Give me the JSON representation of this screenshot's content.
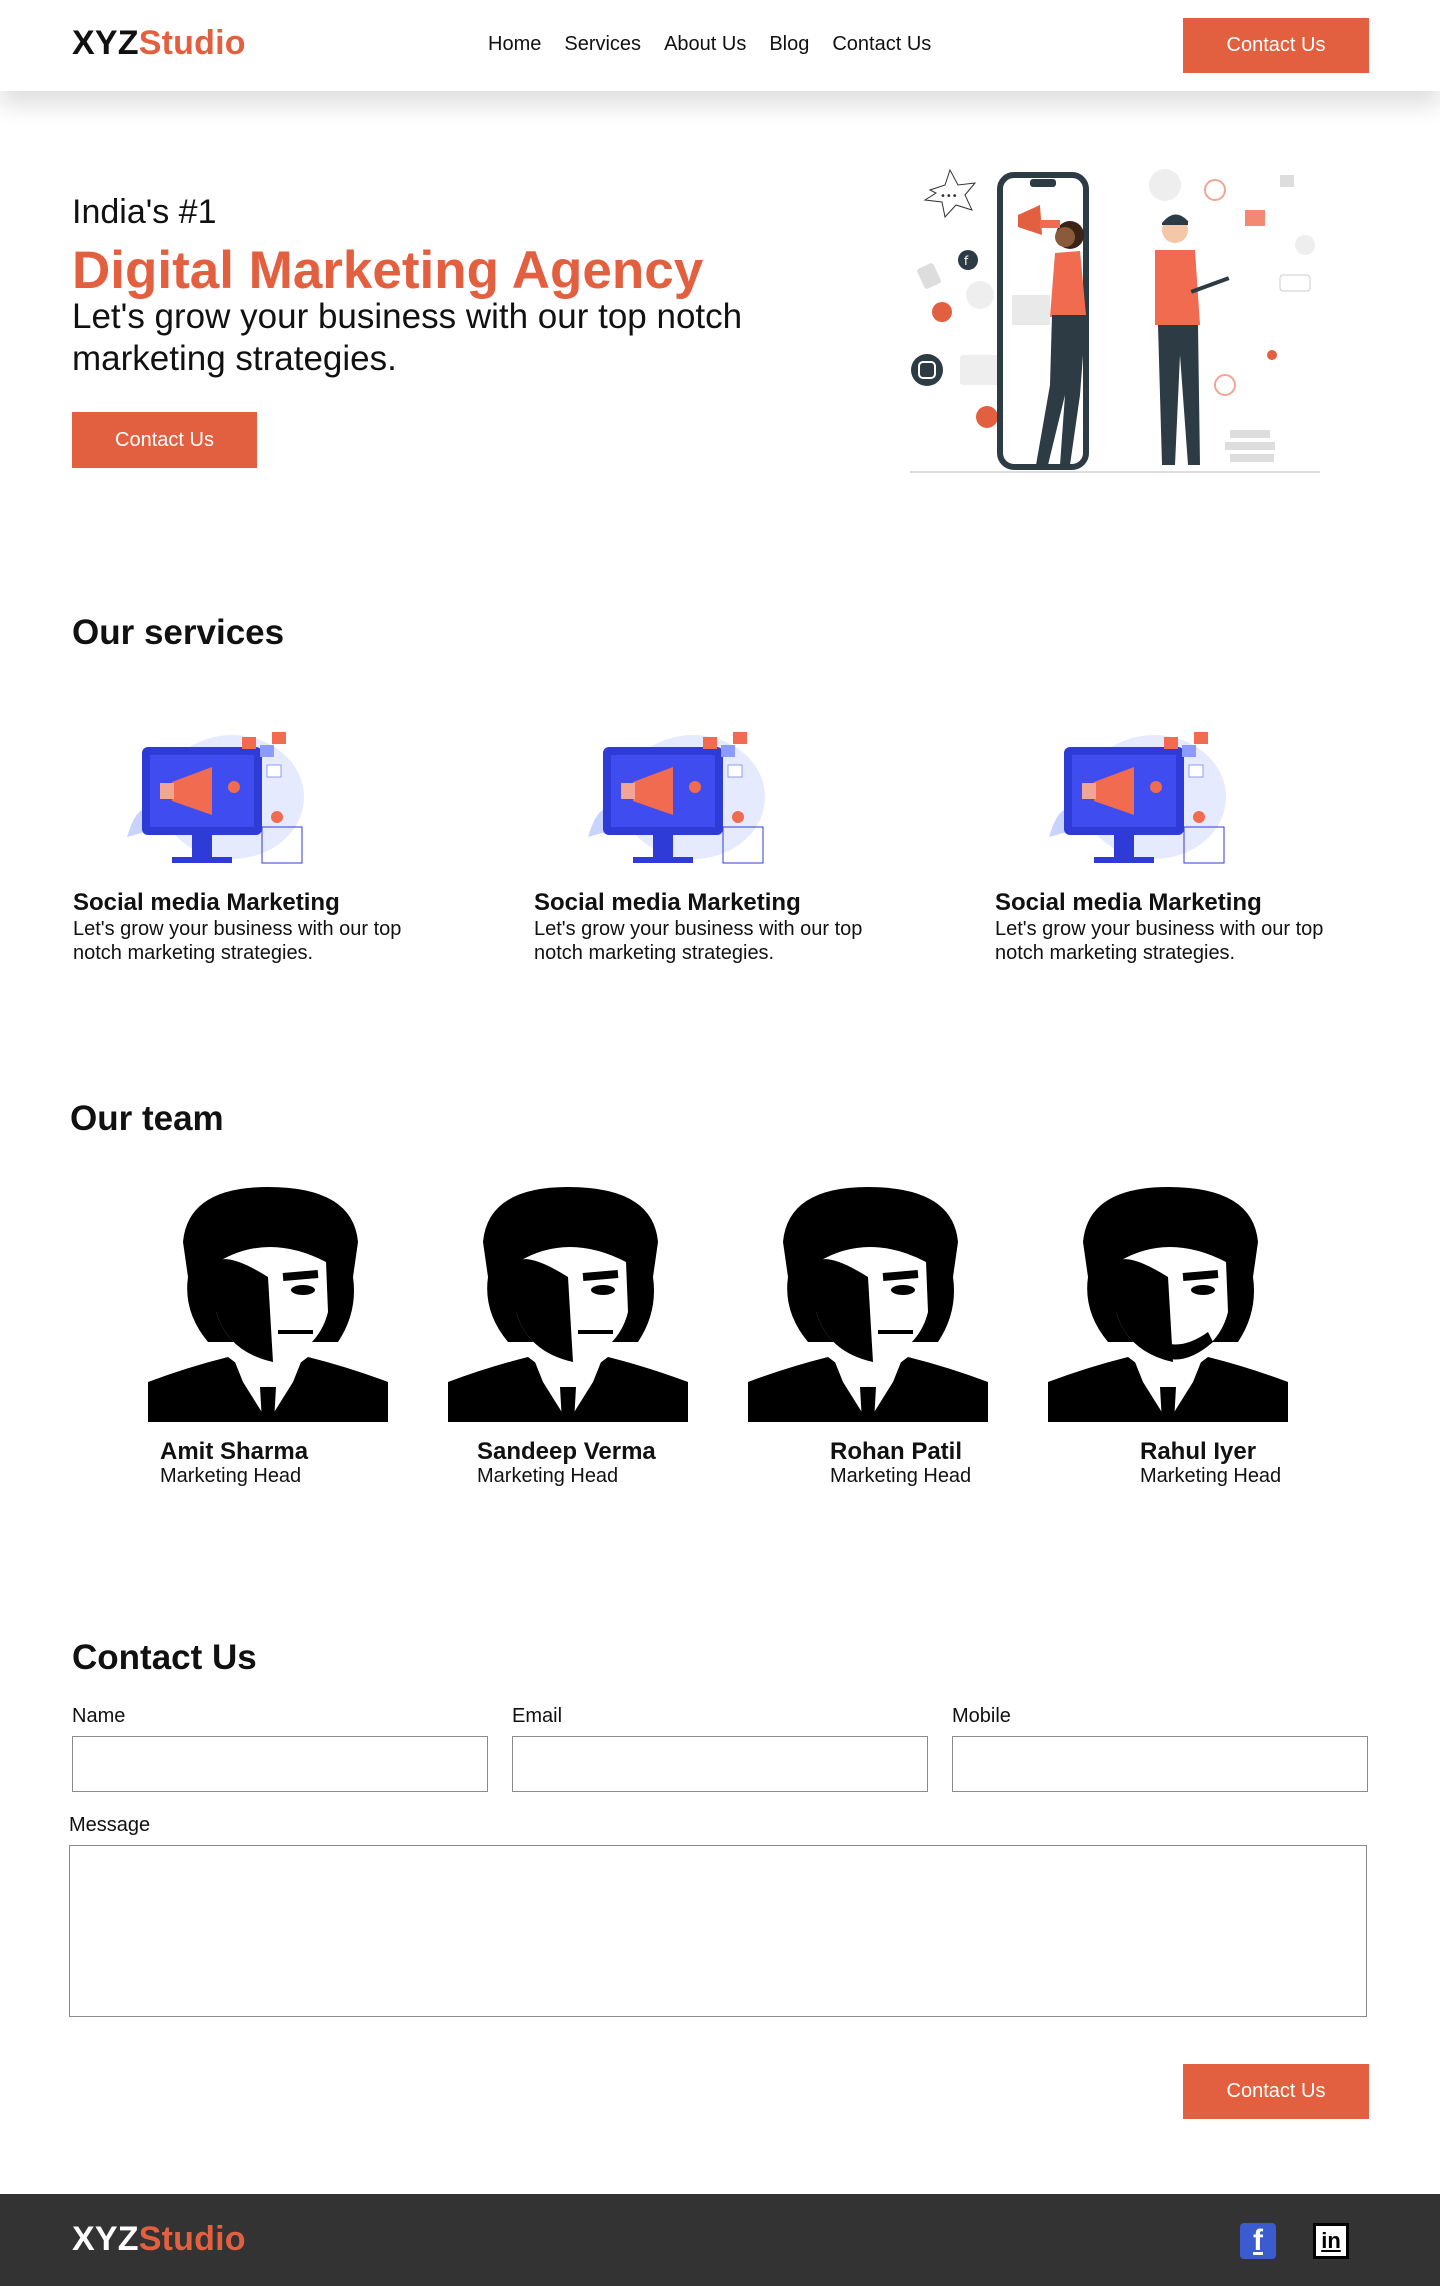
{
  "brand": {
    "part1": "XYZ",
    "part2": "Studio"
  },
  "colors": {
    "accent": "#e2603f",
    "footer_bg": "#333333",
    "text": "#111111"
  },
  "nav": {
    "items": [
      "Home",
      "Services",
      "About Us",
      "Blog",
      "Contact Us"
    ],
    "cta_label": "Contact Us"
  },
  "hero": {
    "eyebrow": "India's #1",
    "title": "Digital Marketing Agency",
    "subtitle": "Let's grow your business with our top notch marketing strategies.",
    "cta_label": "Contact Us",
    "illustration_icon": "marketing-illustration"
  },
  "services": {
    "heading": "Our services",
    "items": [
      {
        "title": "Social media Marketing",
        "description": "Let's grow your business with our top notch marketing strategies.",
        "icon": "megaphone-monitor-illustration"
      },
      {
        "title": "Social media Marketing",
        "description": "Let's grow your business with our top notch marketing strategies.",
        "icon": "megaphone-monitor-illustration"
      },
      {
        "title": "Social media Marketing",
        "description": "Let's grow your business with our top notch marketing strategies.",
        "icon": "megaphone-monitor-illustration"
      }
    ]
  },
  "team": {
    "heading": "Our team",
    "members": [
      {
        "name": "Amit Sharma",
        "role": "Marketing Head"
      },
      {
        "name": "Sandeep Verma",
        "role": "Marketing Head"
      },
      {
        "name": "Rohan Patil",
        "role": "Marketing Head"
      },
      {
        "name": "Rahul Iyer",
        "role": "Marketing Head"
      }
    ]
  },
  "contact": {
    "heading": "Contact Us",
    "name_label": "Name",
    "name_value": "",
    "email_label": "Email",
    "email_value": "",
    "mobile_label": "Mobile",
    "mobile_value": "",
    "message_label": "Message",
    "message_value": "",
    "submit_label": "Contact Us"
  },
  "footer": {
    "social_icons": [
      "facebook-icon",
      "linkedin-icon"
    ],
    "facebook_glyph": "f",
    "linkedin_glyph": "in"
  }
}
